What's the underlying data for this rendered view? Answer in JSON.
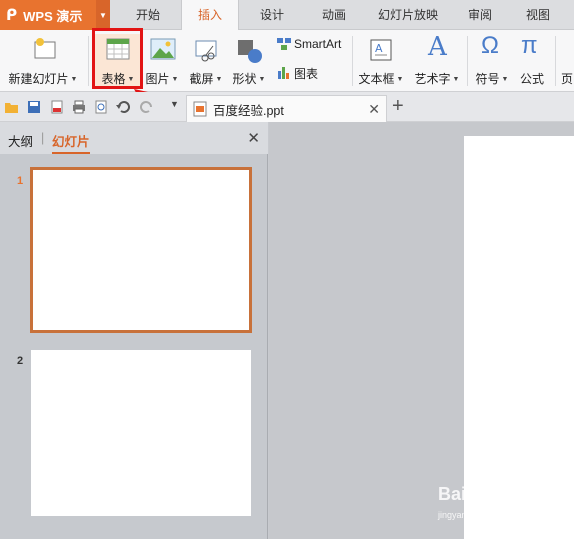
{
  "app": {
    "name": "WPS 演示"
  },
  "menu": {
    "tabs": [
      {
        "label": "开始"
      },
      {
        "label": "插入"
      },
      {
        "label": "设计"
      },
      {
        "label": "动画"
      },
      {
        "label": "幻灯片放映"
      },
      {
        "label": "审阅"
      },
      {
        "label": "视图"
      }
    ],
    "active": "插入"
  },
  "ribbon": {
    "new_slide": "新建幻灯片",
    "table": "表格",
    "picture": "图片",
    "screenshot": "截屏",
    "shape": "形状",
    "smartart": "SmartArt",
    "chart": "图表",
    "textbox": "文本框",
    "wordart": "艺术字",
    "symbol": "符号",
    "formula": "公式",
    "page_cut": "页"
  },
  "document": {
    "tab_name": "百度经验.ppt"
  },
  "left_panel": {
    "tab_outline": "大纲",
    "tab_slides": "幻灯片",
    "slides": [
      {
        "number": "1"
      },
      {
        "number": "2"
      }
    ]
  },
  "watermark": {
    "text": "Bai经验",
    "sub": "jingyan.baidu.com"
  },
  "colors": {
    "accent": "#e8732f",
    "highlight": "#e21414",
    "active_tab_text": "#d8652a"
  }
}
